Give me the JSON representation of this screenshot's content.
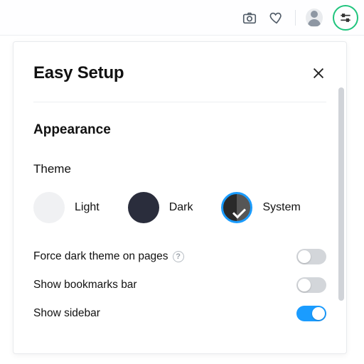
{
  "panel": {
    "title": "Easy Setup",
    "section": "Appearance",
    "theme_heading": "Theme",
    "themes": {
      "light": "Light",
      "dark": "Dark",
      "system": "System"
    },
    "selected_theme": "system",
    "rows": {
      "force_dark": "Force dark theme on pages",
      "bookmarks": "Show bookmarks bar",
      "sidebar": "Show sidebar"
    },
    "toggles": {
      "force_dark": false,
      "bookmarks": false,
      "sidebar": true
    }
  },
  "icons": {
    "camera": "camera-icon",
    "heart": "heart-icon",
    "avatar": "user-avatar-icon",
    "sliders": "settings-sliders-icon",
    "close": "close-icon",
    "help": "?"
  }
}
